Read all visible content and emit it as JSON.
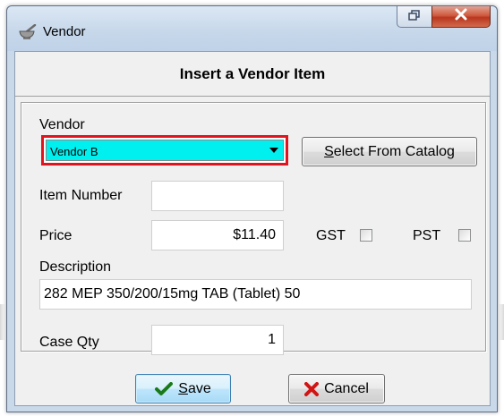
{
  "window": {
    "title": "Vendor",
    "header": "Insert a Vendor Item"
  },
  "form": {
    "vendor_label": "Vendor",
    "vendor_value": "Vendor B",
    "select_catalog_prefix": "S",
    "select_catalog_rest": "elect From Catalog",
    "item_number_label": "Item Number",
    "item_number_value": "",
    "price_label": "Price",
    "price_value": "$11.40",
    "gst_label": "GST",
    "gst_checked": false,
    "pst_label": "PST",
    "pst_checked": false,
    "description_label": "Description",
    "description_value": "282 MEP 350/200/15mg TAB (Tablet) 50",
    "case_qty_label": "Case Qty",
    "case_qty_value": "1"
  },
  "buttons": {
    "save_prefix": "S",
    "save_rest": "ave",
    "cancel_label": "Cancel"
  },
  "colors": {
    "vendor_highlight": "#00f0f0",
    "vendor_border": "#e0141e"
  },
  "icons": {
    "app": "mortar-pestle-icon",
    "restore": "restore-icon",
    "close": "close-icon",
    "dropdown": "chevron-down-icon",
    "save": "checkmark-icon",
    "cancel": "x-icon"
  }
}
